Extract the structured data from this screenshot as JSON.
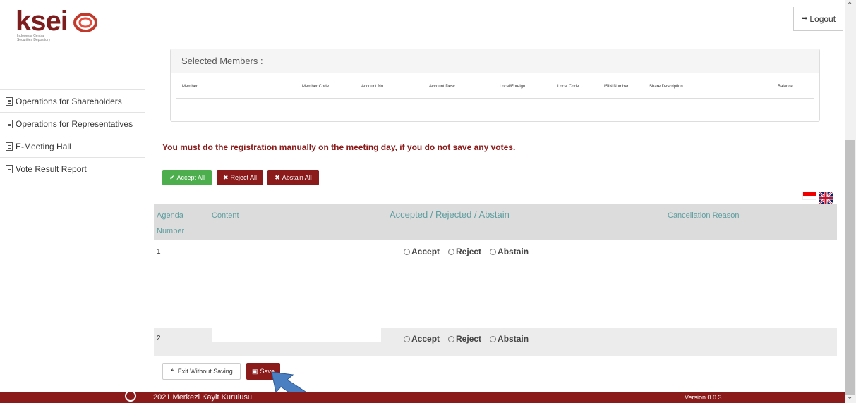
{
  "header": {
    "logo_text": "ksei",
    "logo_sub": "Indonesia Central Securities Depository",
    "logout_label": "Logout"
  },
  "sidebar": {
    "items": [
      {
        "label": "Operations for Shareholders"
      },
      {
        "label": "Operations for Representatives"
      },
      {
        "label": "E-Meeting Hall"
      },
      {
        "label": "Vote Result Report"
      }
    ]
  },
  "members": {
    "title": "Selected Members :",
    "columns": [
      "Member",
      "Member Code",
      "Account No.",
      "Account Desc.",
      "Local/Foreign",
      "Local Code",
      "ISIN Number",
      "Share Description",
      "Balance"
    ]
  },
  "warning": "You must do the registration manually on the meeting day, if you do not save any votes.",
  "bulk_actions": {
    "accept_all": "Accept All",
    "reject_all": "Reject All",
    "abstain_all": "Abstain All"
  },
  "agenda": {
    "headers": {
      "agenda": "Agenda",
      "number": "Number",
      "content": "Content",
      "decision": "Accepted / Rejected / Abstain",
      "cancellation": "Cancellation Reason"
    },
    "rows": [
      {
        "number": "1",
        "options": [
          "Accept",
          "Reject",
          "Abstain"
        ]
      },
      {
        "number": "2",
        "options": [
          "Accept",
          "Reject",
          "Abstain"
        ]
      }
    ]
  },
  "actions": {
    "exit_label": "Exit Without Saving",
    "save_label": "Save"
  },
  "footer": {
    "copyright": "2021 Merkezi Kayit Kurulusu",
    "version": "Version 0.0.3"
  },
  "colors": {
    "brand": "#8b1a1a",
    "accept": "#4cae4c",
    "table_header_text": "#5f9ea0"
  }
}
